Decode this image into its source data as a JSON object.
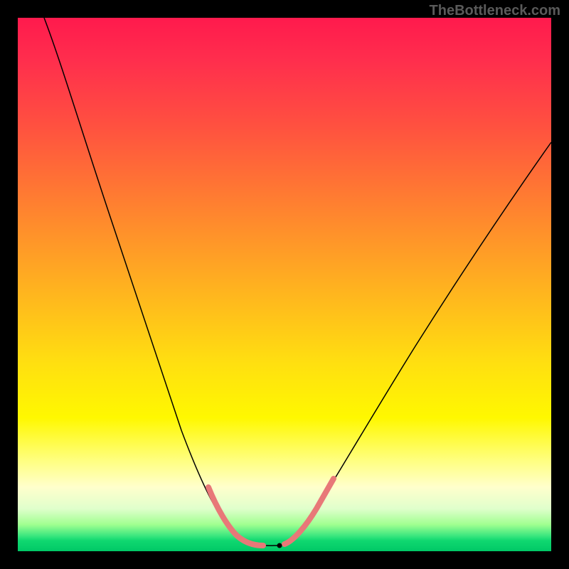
{
  "watermark": "TheBottleneck.com",
  "chart_data": {
    "type": "line",
    "title": "",
    "xlabel": "",
    "ylabel": "",
    "x_range": [
      0,
      100
    ],
    "y_range": [
      0,
      100
    ],
    "series": [
      {
        "name": "bottleneck-curve",
        "x": [
          5,
          8,
          11,
          14,
          17,
          20,
          23,
          26,
          29,
          32,
          34,
          36,
          38,
          40,
          42,
          44,
          46,
          48,
          52,
          56,
          60,
          64,
          68,
          72,
          76,
          80,
          84,
          88,
          92,
          96,
          100
        ],
        "y": [
          100,
          90,
          80,
          71,
          62,
          54,
          46,
          38,
          30,
          23,
          18,
          13,
          9,
          6,
          3,
          1.5,
          1,
          1,
          1.5,
          3,
          6,
          10,
          15,
          21,
          28,
          35,
          43,
          51,
          60,
          69,
          78
        ]
      }
    ],
    "highlight": {
      "name": "optimal-range",
      "x_range": [
        36,
        57
      ],
      "color": "#e87878"
    },
    "minimum_point": {
      "x": 49,
      "y": 1
    }
  }
}
